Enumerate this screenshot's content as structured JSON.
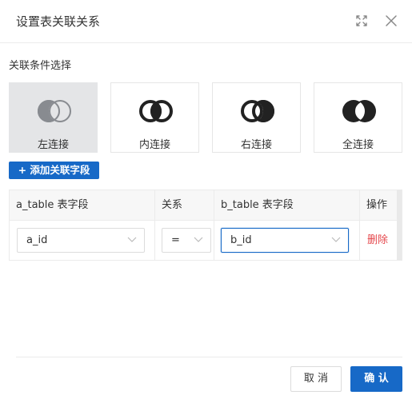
{
  "dialog": {
    "title": "设置表关联关系"
  },
  "join_section": {
    "label": "关联条件选择",
    "options": [
      {
        "label": "左连接",
        "icon": "left-join-icon",
        "selected": true
      },
      {
        "label": "内连接",
        "icon": "inner-join-icon",
        "selected": false
      },
      {
        "label": "右连接",
        "icon": "right-join-icon",
        "selected": false
      },
      {
        "label": "全连接",
        "icon": "full-join-icon",
        "selected": false
      }
    ]
  },
  "add_field_button": "+ 添加关联字段",
  "table": {
    "headers": [
      "a_table 表字段",
      "关系",
      "b_table 表字段",
      "操作"
    ],
    "rows": [
      {
        "a_field": "a_id",
        "relation": "=",
        "b_field": "b_id",
        "action": "删除"
      }
    ]
  },
  "footer": {
    "cancel": "取 消",
    "confirm": "确 认"
  },
  "colors": {
    "primary": "#1769c7",
    "danger": "#e5484d",
    "selected_card": "#e4e5e7"
  }
}
